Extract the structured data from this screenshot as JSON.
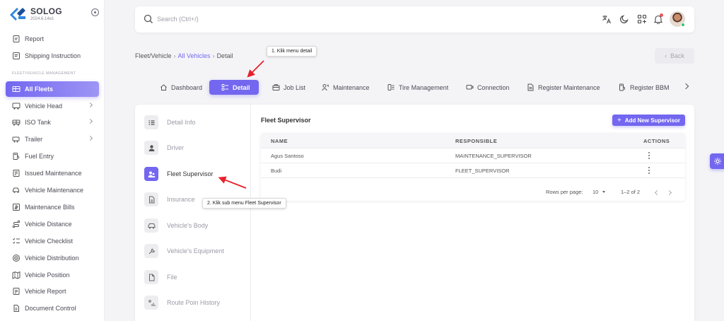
{
  "brand": {
    "name": "SOLOG",
    "version": "2024.6.14e1"
  },
  "sidebar": {
    "section_label": "FLEET/VEHICLE MANAGEMENT",
    "items": [
      {
        "label": "Report"
      },
      {
        "label": "Shipping Instruction"
      },
      {
        "label": "All Fleets"
      },
      {
        "label": "Vehicle Head"
      },
      {
        "label": "ISO Tank"
      },
      {
        "label": "Trailer"
      },
      {
        "label": "Fuel Entry"
      },
      {
        "label": "Issued Maintenance"
      },
      {
        "label": "Vehicle Maintenance"
      },
      {
        "label": "Maintenance Bills"
      },
      {
        "label": "Vehicle Distance"
      },
      {
        "label": "Vehicle Checklist"
      },
      {
        "label": "Vehicle Distribution"
      },
      {
        "label": "Vehicle Position"
      },
      {
        "label": "Vehicle Report"
      },
      {
        "label": "Document Control"
      }
    ]
  },
  "search": {
    "placeholder": "Search (Ctrl+/)"
  },
  "breadcrumb": {
    "root": "Fleet/Vehicle",
    "parent": "All Vehicles",
    "current": "Detail",
    "sep": "›"
  },
  "back_button": {
    "label": "Back"
  },
  "callouts": {
    "step1": "1. Klik menu detail",
    "step2": "2. Klik sub menu Fleet Supervisor"
  },
  "tabs": [
    {
      "label": "Dashboard"
    },
    {
      "label": "Detail"
    },
    {
      "label": "Job List"
    },
    {
      "label": "Maintenance"
    },
    {
      "label": "Tire Management"
    },
    {
      "label": "Connection"
    },
    {
      "label": "Register Maintenance"
    },
    {
      "label": "Register BBM"
    }
  ],
  "sub_menu": [
    {
      "label": "Detail Info"
    },
    {
      "label": "Driver"
    },
    {
      "label": "Fleet Supervisor"
    },
    {
      "label": "Insurance"
    },
    {
      "label": "Vehicle's Body"
    },
    {
      "label": "Vehicle's Equipment"
    },
    {
      "label": "File"
    },
    {
      "label": "Route Poin History"
    }
  ],
  "panel": {
    "title": "Fleet Supervisor",
    "add_button": "Add New Supervisor",
    "columns": {
      "name": "NAME",
      "responsible": "RESPONSIBLE",
      "actions": "ACTIONS"
    },
    "rows": [
      {
        "name": "Agus Santoso",
        "responsible": "MAINTENANCE_SUPERVISOR"
      },
      {
        "name": "Budi",
        "responsible": "FLEET_SUPERVISOR"
      }
    ],
    "pagination": {
      "rows_per_page_label": "Rows per page:",
      "rows_per_page": "10",
      "range": "1–2 of 2"
    }
  },
  "colors": {
    "accent": "#7367f0",
    "annotation": "#e8202a",
    "success": "#28c76f",
    "danger": "#ea5455"
  }
}
